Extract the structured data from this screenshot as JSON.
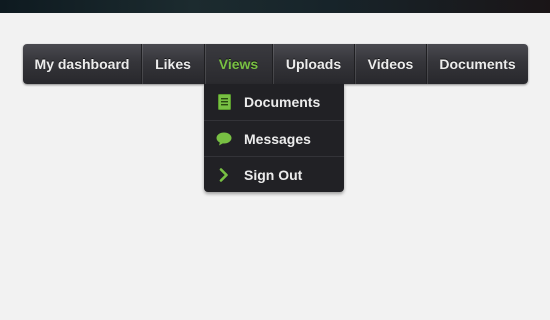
{
  "nav": {
    "items": [
      {
        "label": "My dashboard"
      },
      {
        "label": "Likes"
      },
      {
        "label": "Views",
        "active": true
      },
      {
        "label": "Uploads"
      },
      {
        "label": "Videos"
      },
      {
        "label": "Documents"
      }
    ]
  },
  "dropdown": {
    "items": [
      {
        "label": "Documents",
        "icon": "document-icon"
      },
      {
        "label": "Messages",
        "icon": "chat-bubble-icon"
      },
      {
        "label": "Sign Out",
        "icon": "chevron-right-icon"
      }
    ]
  },
  "colors": {
    "accent": "#78c043",
    "nav_bg": "#35353a",
    "dropdown_bg": "#212125",
    "page_bg": "#f2f2f2"
  }
}
